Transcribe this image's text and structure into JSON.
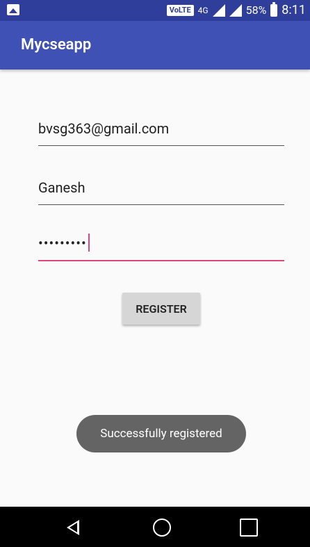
{
  "status_bar": {
    "network_tag": "VoLTE",
    "network_type": "4G",
    "battery_percent": "58%",
    "time": "8:11"
  },
  "app_bar": {
    "title": "Mycseapp"
  },
  "form": {
    "email_value": "bvsg363@gmail.com",
    "name_value": "Ganesh",
    "password_mask": "•••••••••"
  },
  "button": {
    "register_label": "REGISTER"
  },
  "toast": {
    "message": "Successfully registered"
  }
}
